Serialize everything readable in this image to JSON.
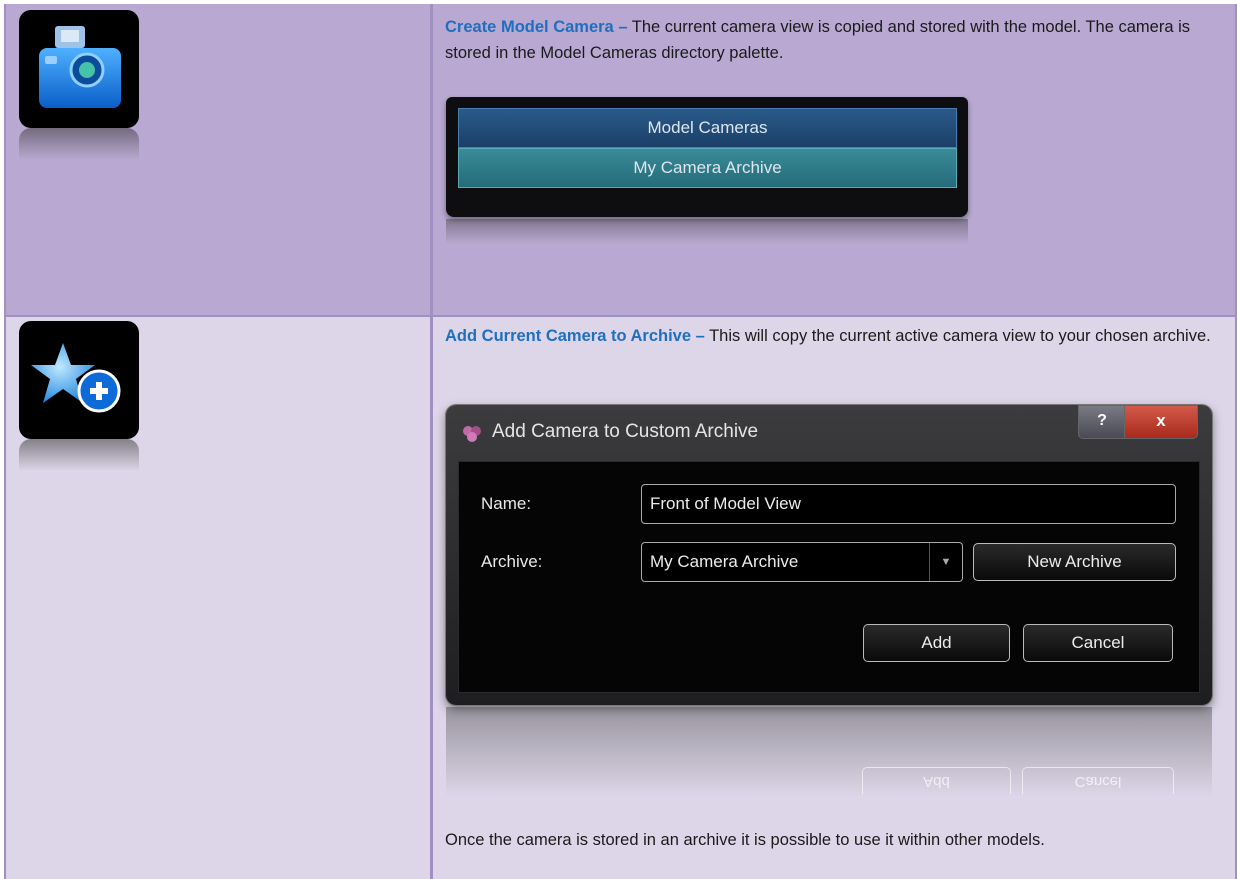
{
  "rows": [
    {
      "icon": "camera-icon",
      "title": "Create Model Camera –",
      "description": " The current camera view is copied and stored with the model. The camera is stored in the Model Cameras directory palette.",
      "palette": {
        "items": [
          "Model Cameras",
          "My Camera Archive"
        ]
      }
    },
    {
      "icon": "star-add-icon",
      "title": "Add Current Camera to Archive –",
      "description": " This will copy the current active camera view to your chosen archive.",
      "dialog": {
        "title": "Add Camera to Custom Archive",
        "help_label": "?",
        "close_label": "x",
        "name_label": "Name:",
        "name_value": "Front of Model View",
        "archive_label": "Archive:",
        "archive_value": "My Camera Archive",
        "new_archive_label": "New Archive",
        "add_label": "Add",
        "cancel_label": "Cancel"
      },
      "footer": "Once the camera is stored in an archive it is possible to use it within other models."
    }
  ],
  "colors": {
    "header_row_bg": "#b9a9d2",
    "body_row_bg": "#ddd6e8",
    "title_blue": "#1f6fbf"
  }
}
